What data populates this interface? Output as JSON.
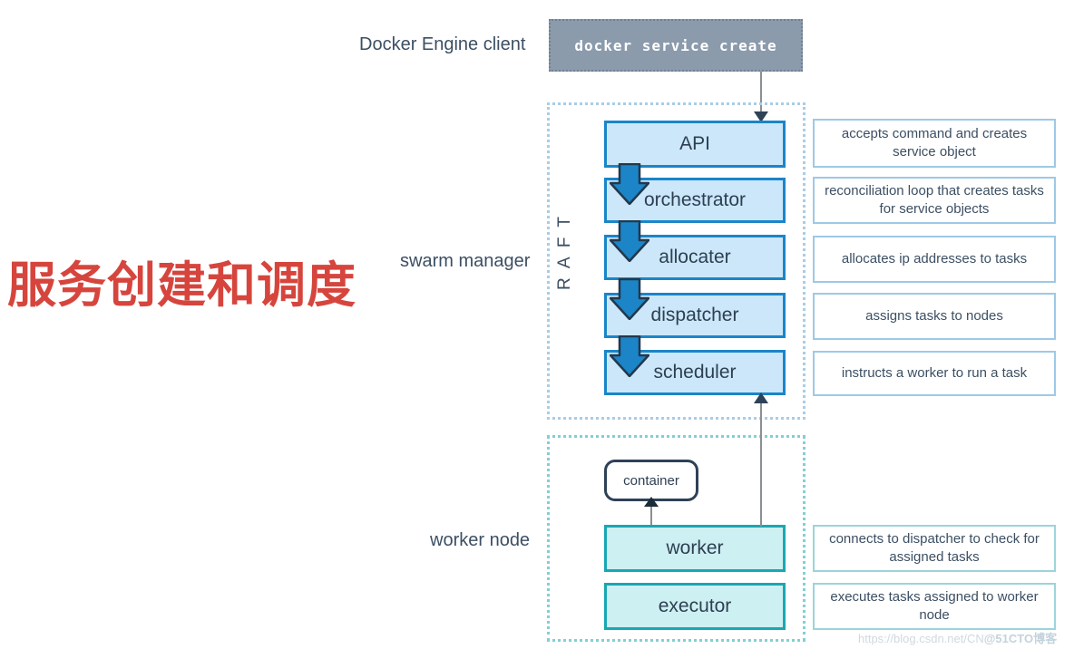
{
  "title_zh": "服务创建和调度",
  "labels": {
    "docker_client": "Docker Engine client",
    "swarm_manager": "swarm manager",
    "worker_node": "worker node",
    "raft": "R A F T"
  },
  "command": {
    "text": "docker service create"
  },
  "manager": {
    "components": [
      {
        "name": "API",
        "note": "accepts command and creates service object"
      },
      {
        "name": "orchestrator",
        "note": "reconciliation loop that creates tasks for service objects"
      },
      {
        "name": "allocater",
        "note": "allocates ip addresses to tasks"
      },
      {
        "name": "dispatcher",
        "note": "assigns tasks to nodes"
      },
      {
        "name": "scheduler",
        "note": "instructs a worker to run a task"
      }
    ]
  },
  "worker": {
    "container_label": "container",
    "components": [
      {
        "name": "worker",
        "note": "connects to dispatcher to check for assigned tasks"
      },
      {
        "name": "executor",
        "note": "executes tasks assigned to worker node"
      }
    ]
  },
  "watermark": {
    "url": "https://blog.csdn.net/CN",
    "brand": "@51CTO博客"
  },
  "colors": {
    "title_red": "#d6453d",
    "manager_fill": "#cbe7f9",
    "manager_stroke": "#1b85c8",
    "worker_fill": "#cdf0f2",
    "worker_stroke": "#19a7b3",
    "command_fill": "#8b9bac",
    "manager_group_border": "#a9cde6",
    "worker_group_border": "#82cfd6",
    "text_dark": "#3c4f63",
    "arrow_gray": "#8b8f93"
  }
}
